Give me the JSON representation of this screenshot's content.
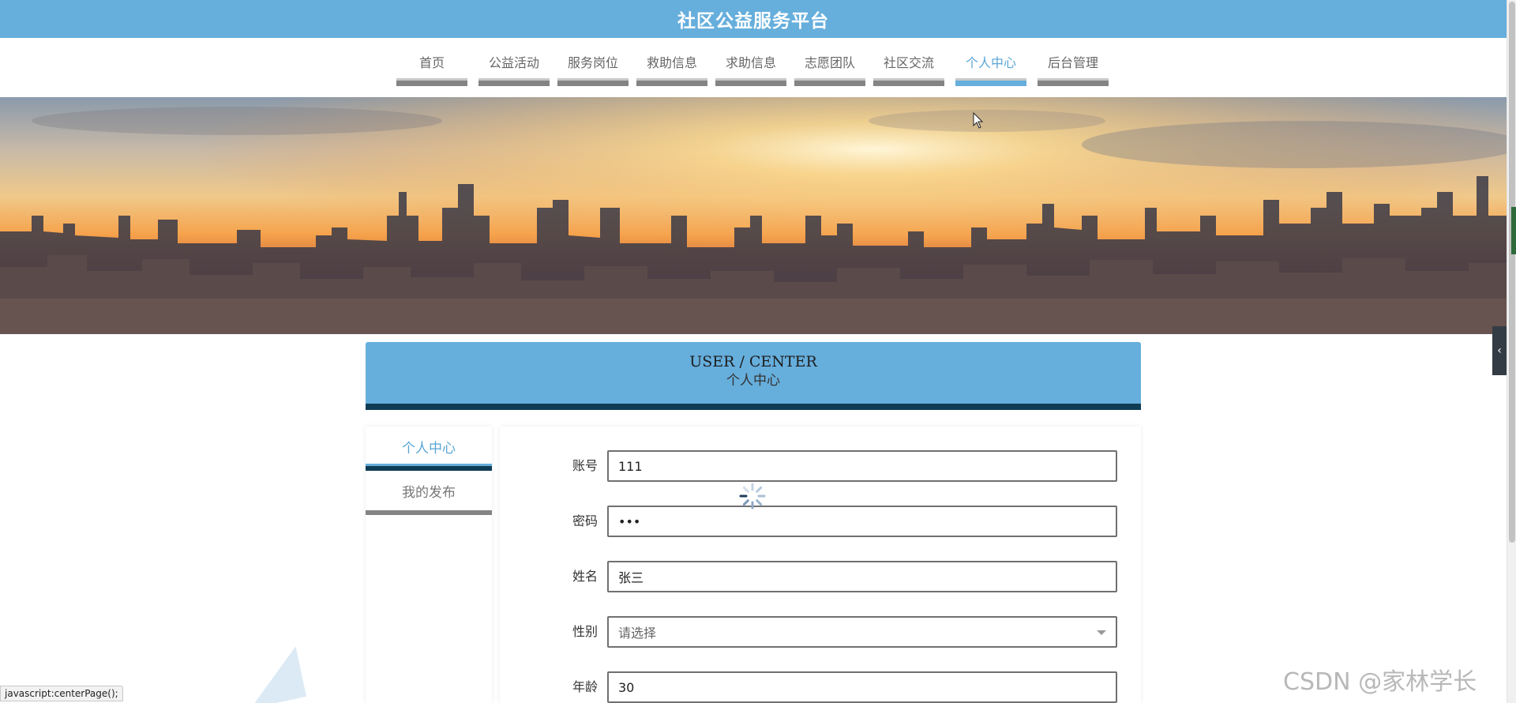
{
  "header": {
    "title": "社区公益服务平台"
  },
  "nav": {
    "items": [
      {
        "label": "首页"
      },
      {
        "label": "公益活动"
      },
      {
        "label": "服务岗位"
      },
      {
        "label": "救助信息"
      },
      {
        "label": "求助信息"
      },
      {
        "label": "志愿团队"
      },
      {
        "label": "社区交流"
      },
      {
        "label": "个人中心",
        "active": true
      },
      {
        "label": "后台管理"
      }
    ]
  },
  "section": {
    "title_en": "USER / CENTER",
    "title_cn": "个人中心"
  },
  "side_menu": {
    "items": [
      {
        "label": "个人中心",
        "active": true
      },
      {
        "label": "我的发布"
      }
    ]
  },
  "form": {
    "fields": [
      {
        "label": "账号",
        "value": "111"
      },
      {
        "label": "密码",
        "value": "•••"
      },
      {
        "label": "姓名",
        "value": "张三"
      },
      {
        "label": "性别",
        "placeholder": "请选择"
      },
      {
        "label": "年龄",
        "value": "30"
      }
    ]
  },
  "status_bar": {
    "text": "javascript:centerPage();"
  },
  "watermark": {
    "text": "CSDN @家林学长"
  },
  "colors": {
    "primary": "#66aedc",
    "dark": "#0f3c55",
    "nav_bar": "#848484"
  }
}
